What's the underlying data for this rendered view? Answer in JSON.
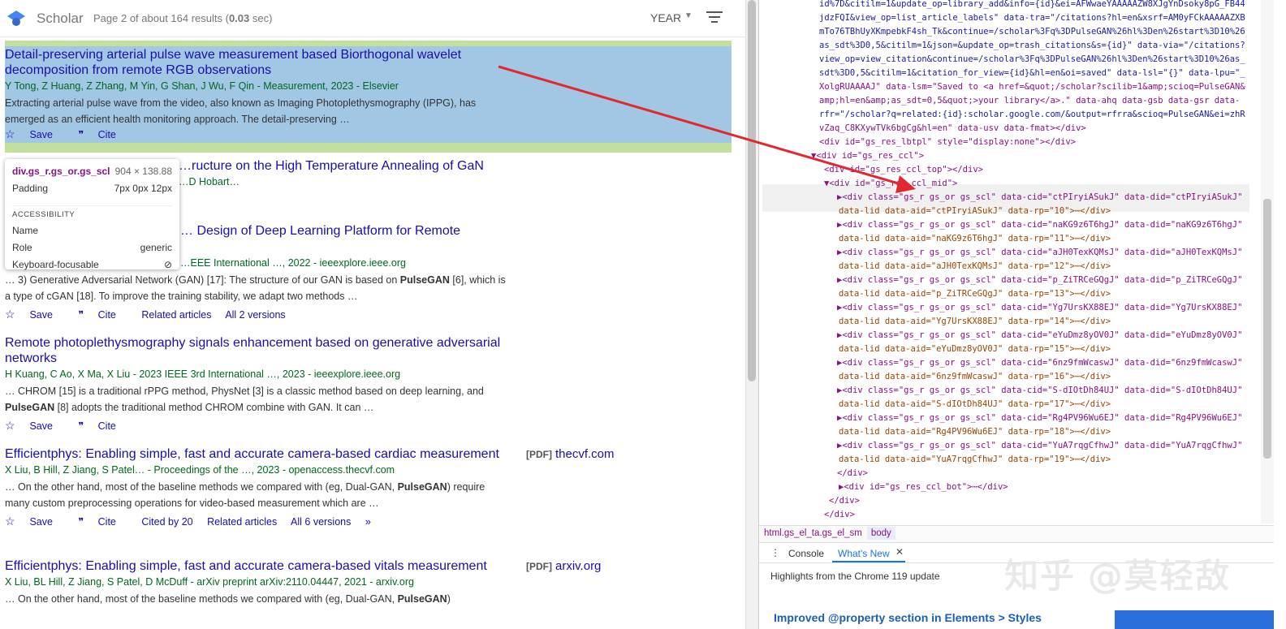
{
  "scholar": {
    "brand": "Scholar",
    "page_info_pre": "Page 2 of about 164 results (",
    "page_info_time": "0.03",
    "page_info_post": " sec)",
    "year_label": "YEAR",
    "results": [
      {
        "title": "Detail-preserving arterial pulse wave measurement based Biorthogonal wavelet decomposition from remote RGB observations",
        "meta": "Y Tong, Z Huang, Z Zhang, M Yin, G Shan, J Wu, F Qin - Measurement, 2023 - Elsevier",
        "snippet": "Extracting arterial pulse wave from the video, also known as Imaging Photoplethysmography (IPPG), has emerged as an efficient health monitoring approach. The detail-preserving …",
        "save": "Save",
        "cite": "Cite"
      },
      {
        "title": "…ructure on the High Temperature Annealing of GaN",
        "meta": "…D Hobart…"
      },
      {
        "title": "… Design of Deep Learning Platform for Remote",
        "meta": "…EEE International …, 2022 - ieeexplore.ieee.org",
        "snippet_pre": "… 3) Generative Adversarial Network (GAN) [17]: The structure of our GAN is based on ",
        "snippet_bold": "PulseGAN",
        "snippet_post": " [6], which is a type of cGAN [18]. To improve the training stability, we adapt two methods …",
        "save": "Save",
        "cite": "Cite",
        "related": "Related articles",
        "versions": "All 2 versions"
      },
      {
        "title": "Remote photoplethysmography signals enhancement based on generative adversarial networks",
        "meta": "H Kuang, C Ao, X Ma, X Liu - 2023 IEEE 3rd International …, 2023 - ieeexplore.ieee.org",
        "snippet_pre": "… CHROM [15] is a traditional rPPG method, PhysNet [3] is a classic method based on deep learning, and ",
        "snippet_bold": "PulseGAN",
        "snippet_post": " [8] adopts the traditional method CHROM combine with GAN. It can …",
        "save": "Save",
        "cite": "Cite"
      },
      {
        "title": "Efficientphys: Enabling simple, fast and accurate camera-based cardiac measurement",
        "meta": "X Liu, B Hill, Z Jiang, S Patel… - Proceedings of the …, 2023 - openaccess.thecvf.com",
        "snippet_pre": "… On the other hand, most of the baseline methods we compared with (eg, Dual-GAN, ",
        "snippet_bold": "PulseGAN",
        "snippet_post": ") require many custom preprocessing operations for video-based measurement which are …",
        "save": "Save",
        "cite": "Cite",
        "citedby": "Cited by 20",
        "related": "Related articles",
        "versions": "All 6 versions",
        "pdf_tag": "[PDF]",
        "pdf_site": "thecvf.com"
      },
      {
        "title": "Efficientphys: Enabling simple, fast and accurate camera-based vitals measurement",
        "meta": "X Liu, BL Hill, Z Jiang, S Patel, D McDuff - arXiv preprint arXiv:2110.04447, 2021 - arxiv.org",
        "snippet_pre": "… On the other hand, most of the baseline methods we compared with (eg, Dual-GAN, ",
        "snippet_bold": "PulseGAN",
        "snippet_post": ")",
        "pdf_tag": "[PDF]",
        "pdf_site": "arxiv.org"
      }
    ]
  },
  "tooltip": {
    "selector": "div.gs_r.gs_or.gs_scl",
    "dims": "904 × 138.88",
    "padding_label": "Padding",
    "padding_value": "7px 0px 12px",
    "acc_header": "ACCESSIBILITY",
    "name_label": "Name",
    "role_label": "Role",
    "role_value": "generic",
    "kb_label": "Keyboard-focusable"
  },
  "devtools": {
    "lines": [
      "id%7D&citilm=1&update_op=library_add&info={id}&ei=AFWwaeYAAAAAZW8XJgYnDsoky8pG_FB44",
      "jdzFQI&view_op=list_article_labels\" data-tra=\"/citations?hl=en&xsrf=AM0yFCkAAAAAZXB",
      "mTo76TBhUyXKmpebkF4sh_Tk&continue=/scholar%3Fq%3DPulseGAN%26hl%3Den%26start%3D10%26",
      "as_sdt%3D0,5&citilm=1&json=&update_op=trash_citations&s={id}\" data-via=\"/citations?",
      "view_op=view_citation&continue=/scholar%3Fq%3DPulseGAN%26hl%3Den%26start%3D10%26as_",
      "sdt%3D0,5&citilm=1&citation_for_view={id}&hl=en&oi=saved\" data-lsl=\"{}\" data-lpu=\"_",
      "XolgRUAAAAJ\" data-lsm=\"Saved to <a href=&quot;/scholar?scilib=1&amp;scioq=PulseGAN&",
      "amp;hl=en&amp;as_sdt=0,5&quot;>your library</a>.\" data-ahq data-gsb data-gsr data-",
      "rfr=\"/scholar?q=related:{id}:scholar.google.com/&output=rfrra&scioq=PulseGAN&ei=zhR",
      "vZaq_C8KXywTVk6bgCg&hl=en\" data-usv data-fmat></div>",
      "<div id=\"gs_res_lbtpl\" style=\"display:none\"></div>",
      "▼<div id=\"gs_res_ccl\">",
      "<div id=\"gs_res_ccl_top\"></div>",
      "▼<div id=\"gs_res_ccl_mid\">",
      "▶<div class=\"gs_r gs_or gs_scl\" data-cid=\"ctPIryiASukJ\" data-did=\"ctPIryiASukJ\"",
      "data-lid data-aid=\"ctPIryiASukJ\" data-rp=\"10\">⋯</div>",
      "▶<div class=\"gs_r gs_or gs_scl\" data-cid=\"naKG9z6T6hgJ\" data-did=\"naKG9z6T6hgJ\"",
      "data-lid data-aid=\"naKG9z6T6hgJ\" data-rp=\"11\">⋯</div>",
      "▶<div class=\"gs_r gs_or gs_scl\" data-cid=\"aJH0TexKQMsJ\" data-did=\"aJH0TexKQMsJ\"",
      "data-lid data-aid=\"aJH0TexKQMsJ\" data-rp=\"12\">⋯</div>",
      "▶<div class=\"gs_r gs_or gs_scl\" data-cid=\"p_ZiTRCeGQgJ\" data-did=\"p_ZiTRCeGQgJ\"",
      "data-lid data-aid=\"p_ZiTRCeGQgJ\" data-rp=\"13\">⋯</div>",
      "▶<div class=\"gs_r gs_or gs_scl\" data-cid=\"Yg7UrsKX88EJ\" data-did=\"Yg7UrsKX88EJ\"",
      "data-lid data-aid=\"Yg7UrsKX88EJ\" data-rp=\"14\">⋯</div>",
      "▶<div class=\"gs_r gs_or gs_scl\" data-cid=\"eYuDmz8yOV0J\" data-did=\"eYuDmz8yOV0J\"",
      "data-lid data-aid=\"eYuDmz8yOV0J\" data-rp=\"15\">⋯</div>",
      "▶<div class=\"gs_r gs_or gs_scl\" data-cid=\"6nz9fmWcaswJ\" data-did=\"6nz9fmWcaswJ\"",
      "data-lid data-aid=\"6nz9fmWcaswJ\" data-rp=\"16\">⋯</div>",
      "▶<div class=\"gs_r gs_or gs_scl\" data-cid=\"S-dIOtDh84UJ\" data-did=\"S-dIOtDh84UJ\"",
      "data-lid data-aid=\"S-dIOtDh84UJ\" data-rp=\"17\">⋯</div>",
      "▶<div class=\"gs_r gs_or gs_scl\" data-cid=\"Rg4PV96Wu6EJ\" data-did=\"Rg4PV96Wu6EJ\"",
      "data-lid data-aid=\"Rg4PV96Wu6EJ\" data-rp=\"18\">⋯</div>",
      "▶<div class=\"gs_r gs_or gs_scl\" data-cid=\"YuA7rqgCfhwJ\" data-did=\"YuA7rqgCfhwJ\"",
      "data-lid data-aid=\"YuA7rqgCfhwJ\" data-rp=\"19\">⋯</div>",
      "</div>",
      "▶<div id=\"gs_res_ccl_bot\">⋯</div>",
      "</div>",
      "</div>",
      "</div>"
    ],
    "crumb_html": "html.gs_el_ta.gs_el_sm",
    "crumb_body": "body",
    "drawer_console": "Console",
    "drawer_whatsnew": "What's New",
    "highlights": "Highlights from the Chrome 119 update",
    "news_title": "Improved @property section in Elements > Styles"
  },
  "watermark": "知乎 @莫轻敌",
  "colors": {
    "link": "#1a0dab",
    "green": "#006621",
    "highlight_content": "#a0c5e8",
    "highlight_padding": "#c3df9e",
    "arrow": "#e0282e"
  }
}
